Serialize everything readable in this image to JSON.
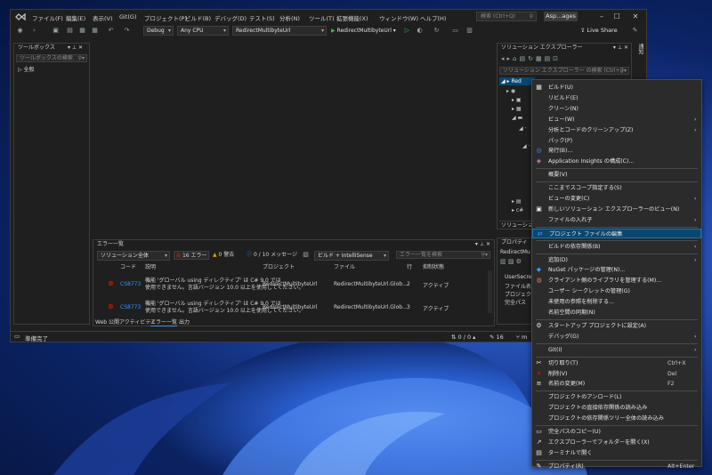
{
  "colors": {
    "accent": "#0e639c",
    "error": "#e51400",
    "warning": "#cca700",
    "info": "#3794ff",
    "highlight": "#094771"
  },
  "menubar": {
    "items": [
      "ファイル(F)",
      "編集(E)",
      "表示(V)",
      "Git(G)",
      "プロジェクト(P)",
      "ビルド(B)",
      "デバッグ(D)",
      "テスト(S)",
      "分析(N)",
      "ツール(T)",
      "拡張機能(X)",
      "ウィンドウ(W)",
      "ヘルプ(H)"
    ]
  },
  "search": {
    "placeholder": "検索 (Ctrl+Q)"
  },
  "window_badge": "Asp...ages",
  "toolbar": {
    "config": "Debug",
    "platform": "Any CPU",
    "project": "RedirectMultibyteUrl",
    "run_target": "RedirectMultibyteUrl",
    "live_share": "Live Share"
  },
  "toolbox": {
    "title": "ツールボックス",
    "search_placeholder": "ツールボックスの検索",
    "group": "全般"
  },
  "side_tab": "通知",
  "solution_explorer": {
    "title": "ソリューション エクスプローラー",
    "search_placeholder": "ソリューション エクスプローラー の検索 (Ctrl+;)",
    "root": "Red",
    "tab": "ソリューション"
  },
  "properties": {
    "title": "プロパティ",
    "item": "RedirectMu",
    "rows": [
      "UserSecre",
      "ファイル名",
      "プロジェクト",
      "完全パス"
    ]
  },
  "error_list": {
    "title": "エラー一覧",
    "scope": "ソリューション全体",
    "errors": "16 エラー",
    "warnings": "0 警告",
    "messages": "0 / 10 メッセージ",
    "build_filter": "ビルド + IntelliSense",
    "search_placeholder": "エラー一覧を検索",
    "columns": [
      "コード",
      "説明",
      "プロジェクト",
      "ファイル",
      "行",
      "抑制状態"
    ],
    "rows": [
      {
        "code": "CS8773",
        "desc1": "機能 'グローバル using ディレクティブ' は C# 9.0 では",
        "desc2": "使用できません。言語バージョン 10.0 以上を使用してください。",
        "project": "RedirectMultibyteUrl",
        "file": "RedirectMultibyteUrl.Glob...",
        "line": "2",
        "state": "アクティブ"
      },
      {
        "code": "CS8773",
        "desc1": "機能 'グローバル using ディレクティブ' は C# 9.0 では",
        "desc2": "使用できません。言語バージョン 10.0 以上を使用してください。",
        "project": "RedirectMultibyteUrl",
        "file": "RedirectMultibyteUrl.Glob...",
        "line": "3",
        "state": "アクティブ"
      }
    ],
    "tabs": [
      "Web 公開アクティビティ",
      "エラー一覧",
      "出力"
    ]
  },
  "statusbar": {
    "ready": "準備完了",
    "updown": "0 / 0",
    "edits": "16"
  },
  "context_menu": [
    {
      "label": "ビルド(U)",
      "icon": "build-icon"
    },
    {
      "label": "リビルド(E)"
    },
    {
      "label": "クリーン(N)"
    },
    {
      "label": "ビュー(W)",
      "sub": true
    },
    {
      "label": "分析とコードのクリーンアップ(Z)",
      "sub": true
    },
    {
      "label": "パック(P)"
    },
    {
      "label": "発行(B)...",
      "icon": "publish-icon"
    },
    {
      "label": "Application Insights の構成(C)...",
      "icon": "insights-icon"
    },
    {
      "sep": true
    },
    {
      "label": "概要(V)"
    },
    {
      "sep": true
    },
    {
      "label": "ここまでスコープ指定する(S)"
    },
    {
      "label": "ビューの変更(C)",
      "sub": true
    },
    {
      "label": "新しいソリューション エクスプローラーのビュー(N)",
      "icon": "new-view-icon"
    },
    {
      "label": "ファイルの入れ子",
      "sub": true
    },
    {
      "sep": true
    },
    {
      "label": "プロジェクト ファイルの編集",
      "icon": "edit-project-icon",
      "hl": true
    },
    {
      "sep": true
    },
    {
      "label": "ビルドの依存関係(B)",
      "sub": true
    },
    {
      "sep": true
    },
    {
      "label": "追加(D)",
      "sub": true
    },
    {
      "label": "NuGet パッケージの管理(N)...",
      "icon": "nuget-icon"
    },
    {
      "label": "クライアント側のライブラリを管理する(M)...",
      "icon": "library-icon"
    },
    {
      "label": "ユーザー シークレットの管理(G)"
    },
    {
      "label": "未使用の参照を削除する..."
    },
    {
      "label": "名前空間の同期(N)"
    },
    {
      "sep": true
    },
    {
      "label": "スタートアップ プロジェクトに設定(A)",
      "icon": "gear-icon"
    },
    {
      "label": "デバッグ(G)",
      "sub": true
    },
    {
      "sep": true
    },
    {
      "label": "Git(I)",
      "sub": true
    },
    {
      "sep": true
    },
    {
      "label": "切り取り(T)",
      "icon": "cut-icon",
      "shortcut": "Ctrl+X"
    },
    {
      "label": "削除(V)",
      "icon": "delete-icon",
      "shortcut": "Del"
    },
    {
      "label": "名前の変更(M)",
      "icon": "rename-icon",
      "shortcut": "F2"
    },
    {
      "sep": true
    },
    {
      "label": "プロジェクトのアンロード(L)"
    },
    {
      "label": "プロジェクトの直接依存関係の読み込み"
    },
    {
      "label": "プロジェクトの依存関係ツリー全体の読み込み"
    },
    {
      "sep": true
    },
    {
      "label": "完全パスのコピー(U)",
      "icon": "copy-icon"
    },
    {
      "label": "エクスプローラーでフォルダーを開く(X)",
      "icon": "folder-open-icon"
    },
    {
      "label": "ターミナルで開く",
      "icon": "terminal-icon"
    },
    {
      "sep": true
    },
    {
      "label": "プロパティ(R)",
      "icon": "wrench-icon",
      "shortcut": "Alt+Enter"
    }
  ]
}
